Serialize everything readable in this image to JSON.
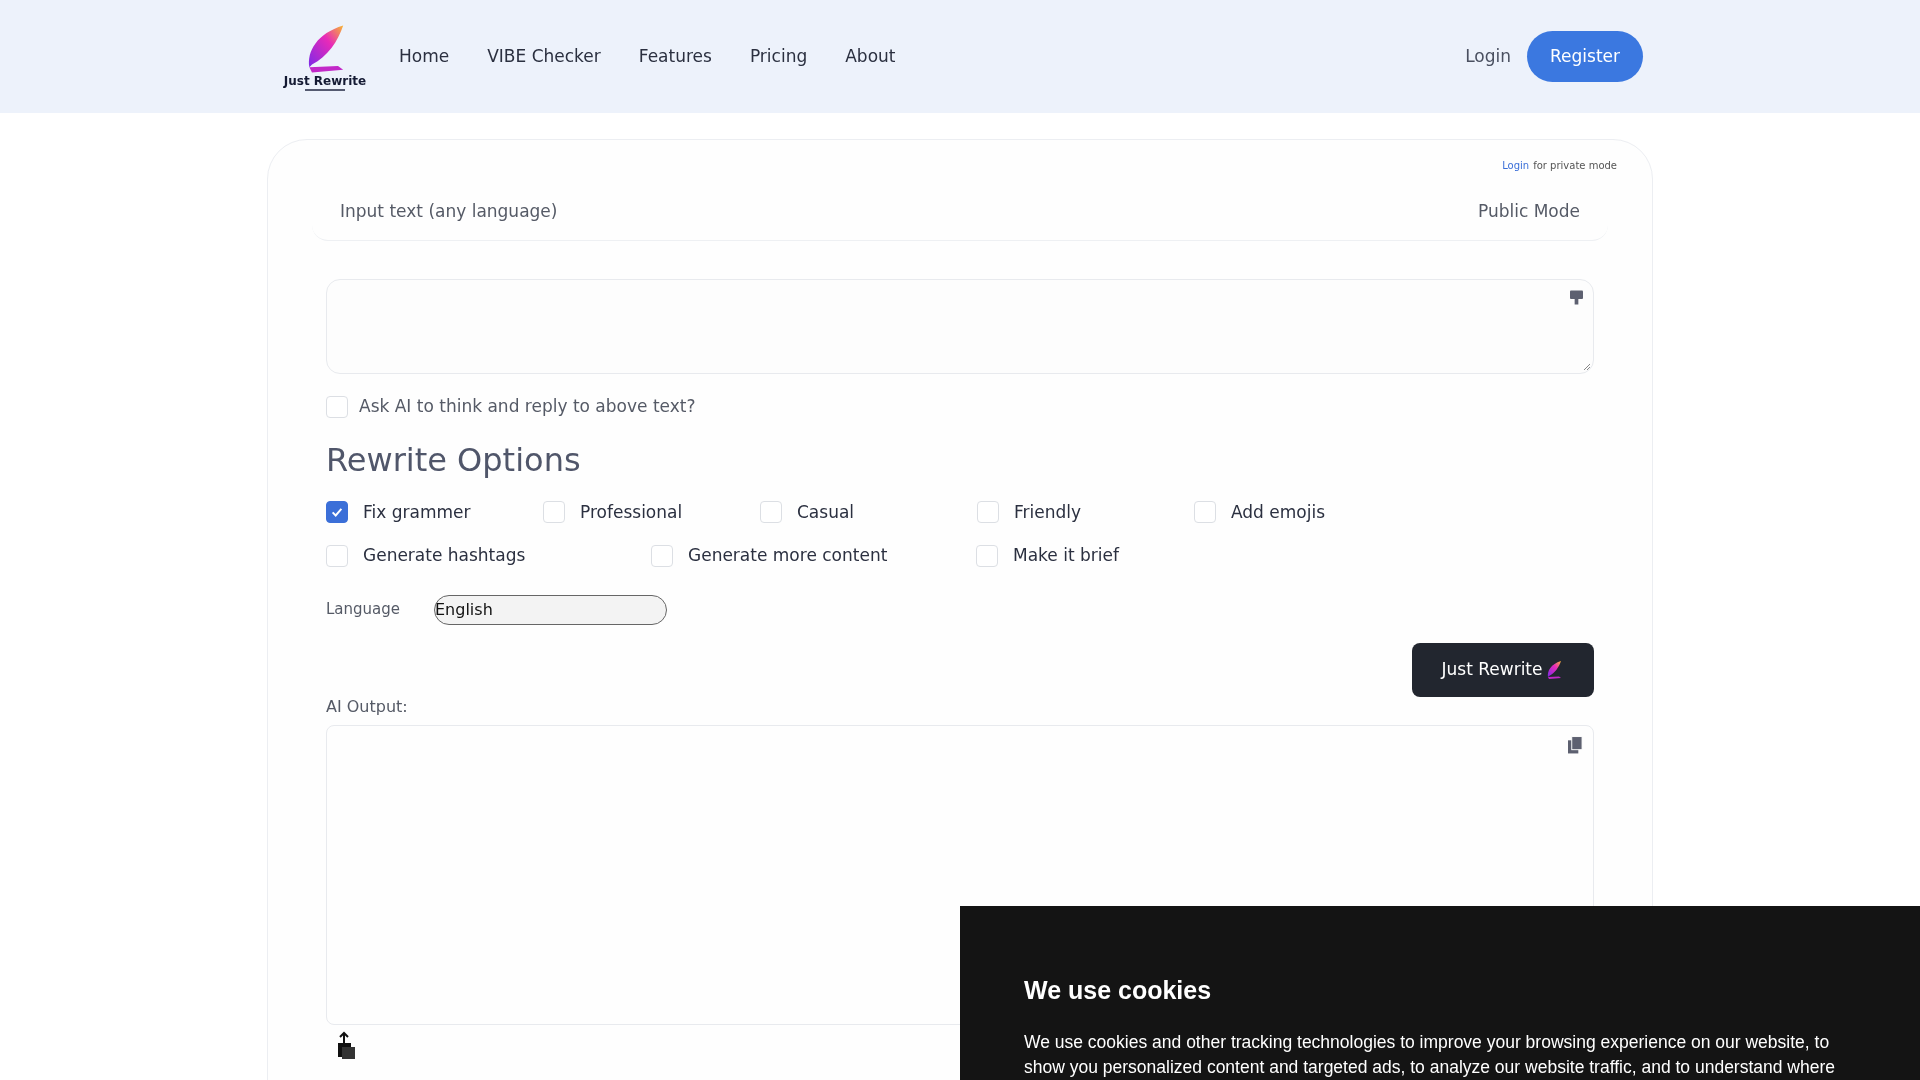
{
  "header": {
    "logo_text": "Just Rewrite",
    "nav": [
      {
        "label": "Home"
      },
      {
        "label": "VIBE Checker"
      },
      {
        "label": "Features"
      },
      {
        "label": "Pricing"
      },
      {
        "label": "About"
      }
    ],
    "login": "Login",
    "register": "Register"
  },
  "editor": {
    "private_link": "Login",
    "private_note": "for private mode",
    "input_label": "Input text (any language)",
    "mode": "Public Mode",
    "think_option": {
      "label": "Ask AI to think and reply to above text?",
      "checked": false
    },
    "options_title": "Rewrite Options",
    "option_rows": [
      [
        {
          "label": "Fix grammer",
          "checked": true
        },
        {
          "label": "Professional",
          "checked": false
        },
        {
          "label": "Casual",
          "checked": false
        },
        {
          "label": "Friendly",
          "checked": false
        },
        {
          "label": "Add emojis",
          "checked": false
        }
      ],
      [
        {
          "label": "Generate hashtags",
          "checked": false
        },
        {
          "label": "Generate more content",
          "checked": false
        },
        {
          "label": "Make it brief",
          "checked": false
        }
      ]
    ],
    "language_label": "Language",
    "language_value": "English",
    "submit": "Just Rewrite",
    "output_label": "AI Output:"
  },
  "cookie_banner": {
    "title": "We use cookies",
    "text": "We use cookies and other tracking technologies to improve your browsing experience on our website, to show you personalized content and targeted ads, to analyze our website traffic, and to understand where"
  }
}
